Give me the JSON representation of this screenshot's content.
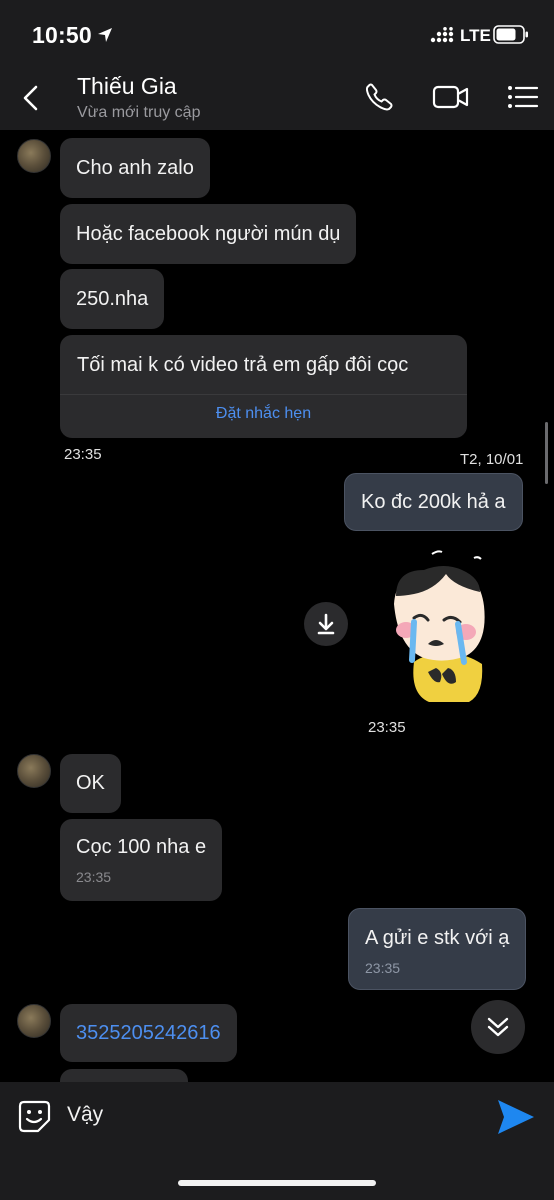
{
  "status_bar": {
    "time": "10:50",
    "network": "LTE"
  },
  "header": {
    "title": "Thiếu Gia",
    "subtitle": "Vừa mới truy cập"
  },
  "messages": [
    {
      "from": "them",
      "text": "Cho anh zalo"
    },
    {
      "from": "them",
      "text": "Hoặc facebook người mún dụ"
    },
    {
      "from": "them",
      "text": "250.nha"
    },
    {
      "from": "them",
      "text": "Tối mai k có video  trả em gấp đôi cọc",
      "action": "Đặt nhắc hẹn",
      "time": "23:35"
    },
    {
      "date_label": "T2, 10/01"
    },
    {
      "from": "me",
      "text": "Ko đc 200k hả a"
    },
    {
      "from": "me",
      "type": "sticker",
      "time": "23:35"
    },
    {
      "from": "them",
      "text": "OK"
    },
    {
      "from": "them",
      "text": "Cọc 100 nha e",
      "time": "23:35"
    },
    {
      "from": "me",
      "text": "A gửi e stk với ạ",
      "time": "23:35"
    },
    {
      "from": "them",
      "text": "3525205242616",
      "is_link": true
    }
  ],
  "input": {
    "value": "Vậy"
  },
  "icons": {
    "back": "chevron-left-icon",
    "call": "phone-icon",
    "video": "video-camera-icon",
    "menu": "list-menu-icon",
    "emoji": "emoji-sticker-icon",
    "send": "send-icon",
    "download": "download-icon",
    "scroll_down": "double-chevron-down-icon"
  },
  "colors": {
    "accent": "#4d8ff0",
    "incoming_bubble": "#2b2b2d",
    "outgoing_bubble": "#353c48",
    "background": "#000000"
  }
}
